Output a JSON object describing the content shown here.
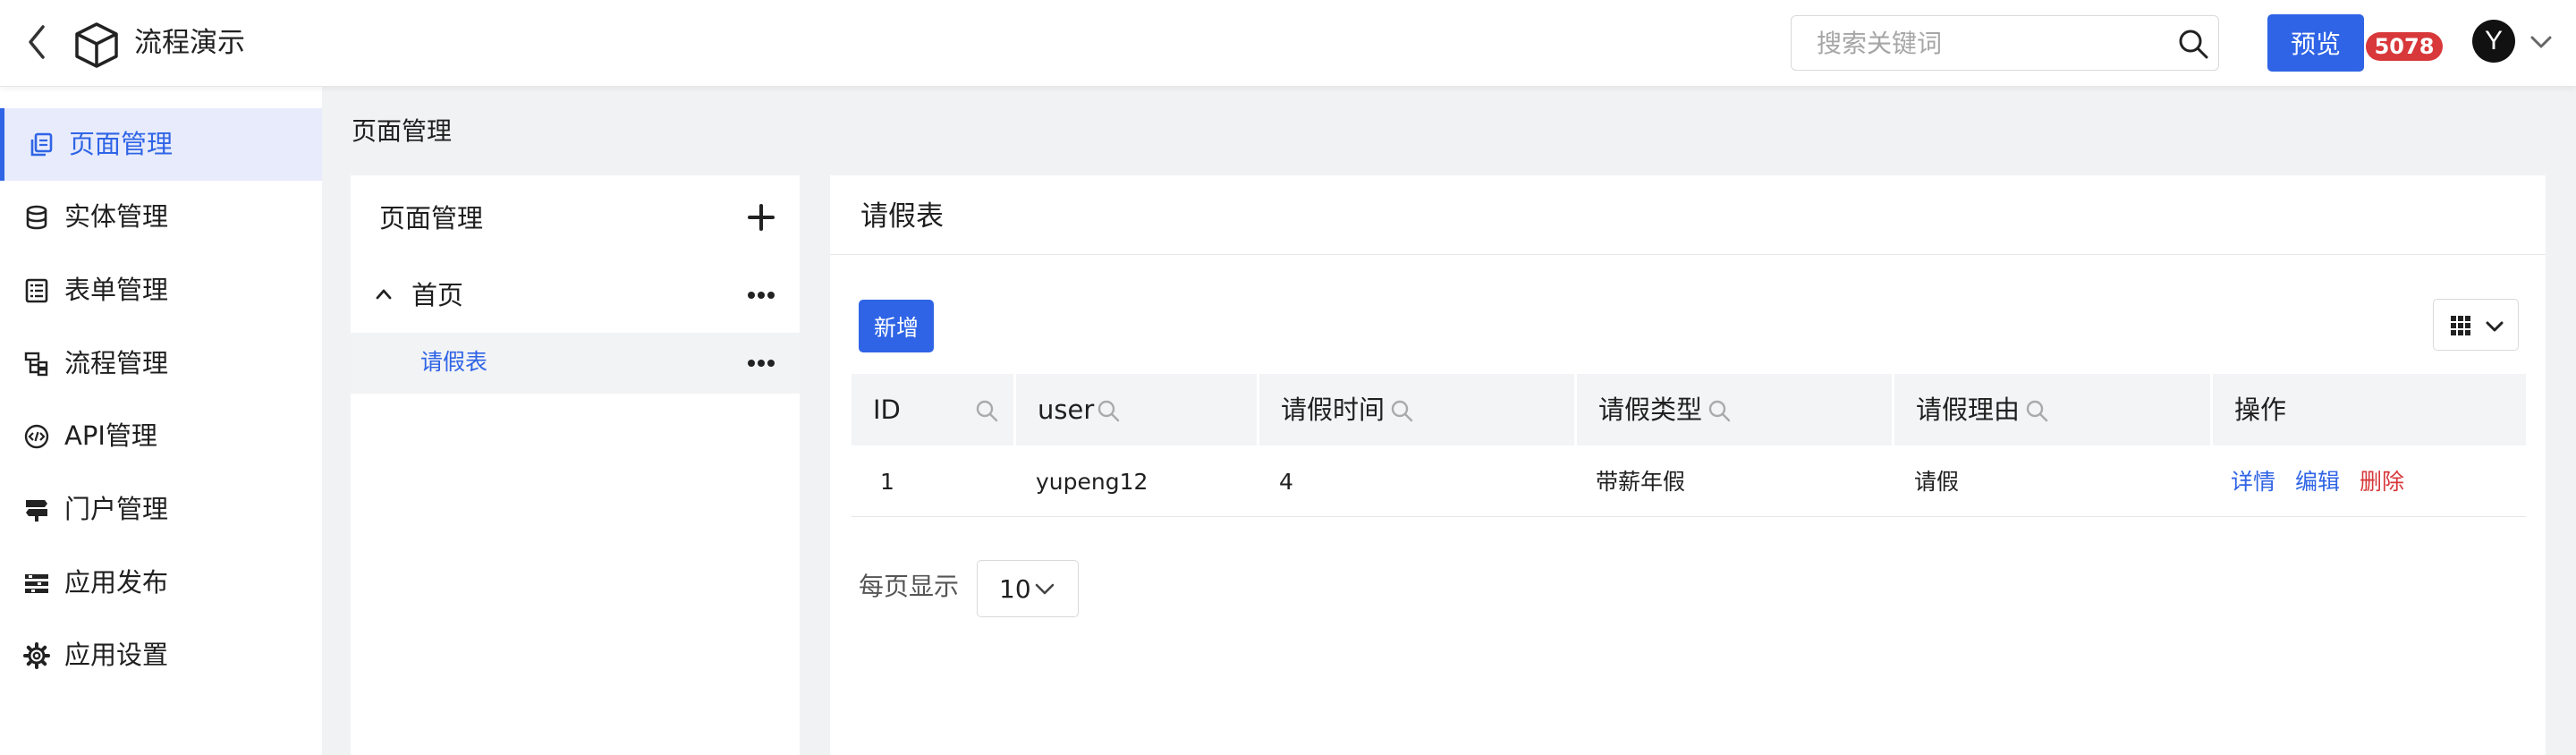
{
  "header": {
    "title": "流程演示",
    "search_placeholder": "搜索关键词",
    "preview_label": "预览",
    "badge_count": "5078",
    "avatar_initial": "Y"
  },
  "sidebar": {
    "items": [
      {
        "label": "页面管理",
        "icon": "page-copy-icon",
        "active": true
      },
      {
        "label": "实体管理",
        "icon": "database-icon",
        "active": false
      },
      {
        "label": "表单管理",
        "icon": "form-list-icon",
        "active": false
      },
      {
        "label": "流程管理",
        "icon": "flow-tree-icon",
        "active": false
      },
      {
        "label": "API管理",
        "icon": "api-code-icon",
        "active": false
      },
      {
        "label": "门户管理",
        "icon": "signpost-icon",
        "active": false
      },
      {
        "label": "应用发布",
        "icon": "publish-bars-icon",
        "active": false
      },
      {
        "label": "应用设置",
        "icon": "gear-icon",
        "active": false
      }
    ]
  },
  "main": {
    "heading": "页面管理",
    "tree": {
      "title": "页面管理",
      "nodes": [
        {
          "label": "首页",
          "expanded": true
        },
        {
          "label": "请假表",
          "selected": true
        }
      ]
    },
    "card": {
      "title": "请假表",
      "add_label": "新增",
      "columns": [
        "ID",
        "user",
        "请假时间",
        "请假类型",
        "请假理由",
        "操作"
      ],
      "rows": [
        {
          "id": "1",
          "user": "yupeng12",
          "time": "4",
          "type": "带薪年假",
          "reason": "请假"
        }
      ],
      "actions": {
        "detail": "详情",
        "edit": "编辑",
        "delete": "删除"
      },
      "pager": {
        "label": "每页显示",
        "page_size": "10"
      }
    }
  },
  "colors": {
    "accent": "#2f64e6",
    "danger": "#d8383a",
    "active_nav_bg": "#e7ebfb"
  }
}
